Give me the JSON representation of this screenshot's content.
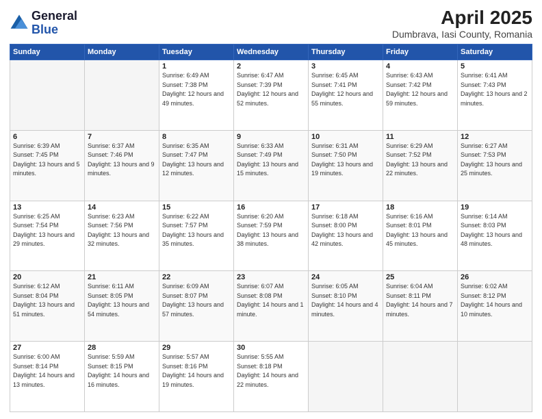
{
  "header": {
    "logo_general": "General",
    "logo_blue": "Blue",
    "title": "April 2025",
    "subtitle": "Dumbrava, Iasi County, Romania"
  },
  "days_of_week": [
    "Sunday",
    "Monday",
    "Tuesday",
    "Wednesday",
    "Thursday",
    "Friday",
    "Saturday"
  ],
  "weeks": [
    [
      {
        "day": "",
        "sunrise": "",
        "sunset": "",
        "daylight": ""
      },
      {
        "day": "",
        "sunrise": "",
        "sunset": "",
        "daylight": ""
      },
      {
        "day": "1",
        "sunrise": "Sunrise: 6:49 AM",
        "sunset": "Sunset: 7:38 PM",
        "daylight": "Daylight: 12 hours and 49 minutes."
      },
      {
        "day": "2",
        "sunrise": "Sunrise: 6:47 AM",
        "sunset": "Sunset: 7:39 PM",
        "daylight": "Daylight: 12 hours and 52 minutes."
      },
      {
        "day": "3",
        "sunrise": "Sunrise: 6:45 AM",
        "sunset": "Sunset: 7:41 PM",
        "daylight": "Daylight: 12 hours and 55 minutes."
      },
      {
        "day": "4",
        "sunrise": "Sunrise: 6:43 AM",
        "sunset": "Sunset: 7:42 PM",
        "daylight": "Daylight: 12 hours and 59 minutes."
      },
      {
        "day": "5",
        "sunrise": "Sunrise: 6:41 AM",
        "sunset": "Sunset: 7:43 PM",
        "daylight": "Daylight: 13 hours and 2 minutes."
      }
    ],
    [
      {
        "day": "6",
        "sunrise": "Sunrise: 6:39 AM",
        "sunset": "Sunset: 7:45 PM",
        "daylight": "Daylight: 13 hours and 5 minutes."
      },
      {
        "day": "7",
        "sunrise": "Sunrise: 6:37 AM",
        "sunset": "Sunset: 7:46 PM",
        "daylight": "Daylight: 13 hours and 9 minutes."
      },
      {
        "day": "8",
        "sunrise": "Sunrise: 6:35 AM",
        "sunset": "Sunset: 7:47 PM",
        "daylight": "Daylight: 13 hours and 12 minutes."
      },
      {
        "day": "9",
        "sunrise": "Sunrise: 6:33 AM",
        "sunset": "Sunset: 7:49 PM",
        "daylight": "Daylight: 13 hours and 15 minutes."
      },
      {
        "day": "10",
        "sunrise": "Sunrise: 6:31 AM",
        "sunset": "Sunset: 7:50 PM",
        "daylight": "Daylight: 13 hours and 19 minutes."
      },
      {
        "day": "11",
        "sunrise": "Sunrise: 6:29 AM",
        "sunset": "Sunset: 7:52 PM",
        "daylight": "Daylight: 13 hours and 22 minutes."
      },
      {
        "day": "12",
        "sunrise": "Sunrise: 6:27 AM",
        "sunset": "Sunset: 7:53 PM",
        "daylight": "Daylight: 13 hours and 25 minutes."
      }
    ],
    [
      {
        "day": "13",
        "sunrise": "Sunrise: 6:25 AM",
        "sunset": "Sunset: 7:54 PM",
        "daylight": "Daylight: 13 hours and 29 minutes."
      },
      {
        "day": "14",
        "sunrise": "Sunrise: 6:23 AM",
        "sunset": "Sunset: 7:56 PM",
        "daylight": "Daylight: 13 hours and 32 minutes."
      },
      {
        "day": "15",
        "sunrise": "Sunrise: 6:22 AM",
        "sunset": "Sunset: 7:57 PM",
        "daylight": "Daylight: 13 hours and 35 minutes."
      },
      {
        "day": "16",
        "sunrise": "Sunrise: 6:20 AM",
        "sunset": "Sunset: 7:59 PM",
        "daylight": "Daylight: 13 hours and 38 minutes."
      },
      {
        "day": "17",
        "sunrise": "Sunrise: 6:18 AM",
        "sunset": "Sunset: 8:00 PM",
        "daylight": "Daylight: 13 hours and 42 minutes."
      },
      {
        "day": "18",
        "sunrise": "Sunrise: 6:16 AM",
        "sunset": "Sunset: 8:01 PM",
        "daylight": "Daylight: 13 hours and 45 minutes."
      },
      {
        "day": "19",
        "sunrise": "Sunrise: 6:14 AM",
        "sunset": "Sunset: 8:03 PM",
        "daylight": "Daylight: 13 hours and 48 minutes."
      }
    ],
    [
      {
        "day": "20",
        "sunrise": "Sunrise: 6:12 AM",
        "sunset": "Sunset: 8:04 PM",
        "daylight": "Daylight: 13 hours and 51 minutes."
      },
      {
        "day": "21",
        "sunrise": "Sunrise: 6:11 AM",
        "sunset": "Sunset: 8:05 PM",
        "daylight": "Daylight: 13 hours and 54 minutes."
      },
      {
        "day": "22",
        "sunrise": "Sunrise: 6:09 AM",
        "sunset": "Sunset: 8:07 PM",
        "daylight": "Daylight: 13 hours and 57 minutes."
      },
      {
        "day": "23",
        "sunrise": "Sunrise: 6:07 AM",
        "sunset": "Sunset: 8:08 PM",
        "daylight": "Daylight: 14 hours and 1 minute."
      },
      {
        "day": "24",
        "sunrise": "Sunrise: 6:05 AM",
        "sunset": "Sunset: 8:10 PM",
        "daylight": "Daylight: 14 hours and 4 minutes."
      },
      {
        "day": "25",
        "sunrise": "Sunrise: 6:04 AM",
        "sunset": "Sunset: 8:11 PM",
        "daylight": "Daylight: 14 hours and 7 minutes."
      },
      {
        "day": "26",
        "sunrise": "Sunrise: 6:02 AM",
        "sunset": "Sunset: 8:12 PM",
        "daylight": "Daylight: 14 hours and 10 minutes."
      }
    ],
    [
      {
        "day": "27",
        "sunrise": "Sunrise: 6:00 AM",
        "sunset": "Sunset: 8:14 PM",
        "daylight": "Daylight: 14 hours and 13 minutes."
      },
      {
        "day": "28",
        "sunrise": "Sunrise: 5:59 AM",
        "sunset": "Sunset: 8:15 PM",
        "daylight": "Daylight: 14 hours and 16 minutes."
      },
      {
        "day": "29",
        "sunrise": "Sunrise: 5:57 AM",
        "sunset": "Sunset: 8:16 PM",
        "daylight": "Daylight: 14 hours and 19 minutes."
      },
      {
        "day": "30",
        "sunrise": "Sunrise: 5:55 AM",
        "sunset": "Sunset: 8:18 PM",
        "daylight": "Daylight: 14 hours and 22 minutes."
      },
      {
        "day": "",
        "sunrise": "",
        "sunset": "",
        "daylight": ""
      },
      {
        "day": "",
        "sunrise": "",
        "sunset": "",
        "daylight": ""
      },
      {
        "day": "",
        "sunrise": "",
        "sunset": "",
        "daylight": ""
      }
    ]
  ]
}
